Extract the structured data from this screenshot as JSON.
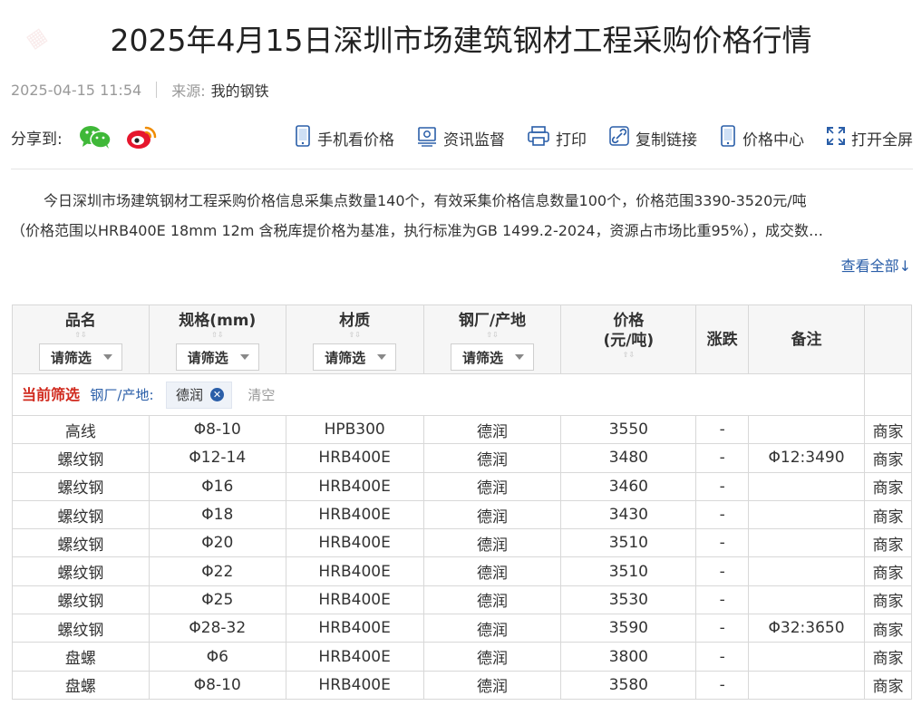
{
  "article": {
    "title": "2025年4月15日深圳市场建筑钢材工程采购价格行情",
    "datetime": "2025-04-15 11:54",
    "source_label": "来源:",
    "source_value": "我的钢铁"
  },
  "share": {
    "label": "分享到:",
    "icons": [
      "wechat-icon",
      "weibo-icon"
    ]
  },
  "tools": [
    {
      "label": "手机看价格",
      "icon": "mobile-icon"
    },
    {
      "label": "资讯监督",
      "icon": "supervise-icon"
    },
    {
      "label": "打印",
      "icon": "printer-icon"
    },
    {
      "label": "复制链接",
      "icon": "link-icon"
    },
    {
      "label": "价格中心",
      "icon": "price-center-icon"
    },
    {
      "label": "打开全屏",
      "icon": "fullscreen-icon"
    }
  ],
  "summary": {
    "line1": "今日深圳市场建筑钢材工程采购价格信息采集点数量140个，有效采集价格信息数量100个，价格范围3390-3520元/吨",
    "line2": "（价格范围以HRB400E 18mm 12m 含税库提价格为基准，执行标准为GB 1499.2-2024，资源占市场比重95%），成交数…",
    "view_all": "查看全部↓"
  },
  "table": {
    "headers": {
      "name": "品名",
      "spec": "规格(mm)",
      "material": "材质",
      "mill": "钢厂/产地",
      "price_line1": "价格",
      "price_line2": "(元/吨)",
      "change": "涨跌",
      "note": "备注"
    },
    "filter_placeholder": "请筛选",
    "current_filter": {
      "label": "当前筛选",
      "criterion": "钢厂/产地:",
      "value": "德润",
      "clear": "清空"
    },
    "rows": [
      {
        "name": "高线",
        "spec": "Φ8-10",
        "material": "HPB300",
        "mill": "德润",
        "price": "3550",
        "change": "-",
        "note": "",
        "action": "商家"
      },
      {
        "name": "螺纹钢",
        "spec": "Φ12-14",
        "material": "HRB400E",
        "mill": "德润",
        "price": "3480",
        "change": "-",
        "note": "Φ12:3490",
        "action": "商家"
      },
      {
        "name": "螺纹钢",
        "spec": "Φ16",
        "material": "HRB400E",
        "mill": "德润",
        "price": "3460",
        "change": "-",
        "note": "",
        "action": "商家"
      },
      {
        "name": "螺纹钢",
        "spec": "Φ18",
        "material": "HRB400E",
        "mill": "德润",
        "price": "3430",
        "change": "-",
        "note": "",
        "action": "商家"
      },
      {
        "name": "螺纹钢",
        "spec": "Φ20",
        "material": "HRB400E",
        "mill": "德润",
        "price": "3510",
        "change": "-",
        "note": "",
        "action": "商家"
      },
      {
        "name": "螺纹钢",
        "spec": "Φ22",
        "material": "HRB400E",
        "mill": "德润",
        "price": "3510",
        "change": "-",
        "note": "",
        "action": "商家"
      },
      {
        "name": "螺纹钢",
        "spec": "Φ25",
        "material": "HRB400E",
        "mill": "德润",
        "price": "3530",
        "change": "-",
        "note": "",
        "action": "商家"
      },
      {
        "name": "螺纹钢",
        "spec": "Φ28-32",
        "material": "HRB400E",
        "mill": "德润",
        "price": "3590",
        "change": "-",
        "note": "Φ32:3650",
        "action": "商家"
      },
      {
        "name": "盘螺",
        "spec": "Φ6",
        "material": "HRB400E",
        "mill": "德润",
        "price": "3800",
        "change": "-",
        "note": "",
        "action": "商家"
      },
      {
        "name": "盘螺",
        "spec": "Φ8-10",
        "material": "HRB400E",
        "mill": "德润",
        "price": "3580",
        "change": "-",
        "note": "",
        "action": "商家"
      }
    ]
  },
  "colors": {
    "link_blue": "#2a5ea8",
    "current_filter_red": "#d0291d",
    "wechat_green": "#3fb838",
    "weibo_red": "#e6162d",
    "header_bg": "#f6f6f6"
  }
}
